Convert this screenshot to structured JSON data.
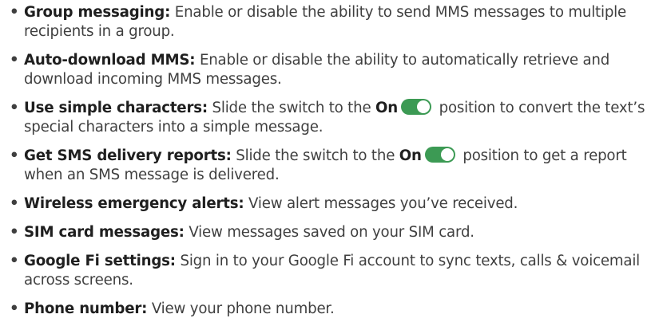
{
  "colors": {
    "text": "#3f3f3f",
    "bold_text": "#1f1f1f",
    "toggle_on": "#3c9a54"
  },
  "bullet": "•",
  "items": [
    {
      "term": "Group messaging:",
      "text": " Enable or disable the ability to send MMS messages to multiple recipients in a group."
    },
    {
      "term": "Auto-download MMS:",
      "text": " Enable or disable the ability to automatically retrieve and download incoming MMS messages."
    },
    {
      "term": "Use simple characters:",
      "text_before": " Slide the switch to the ",
      "on_label": "On",
      "toggle_state": "on",
      "text_after": " position to convert the text’s special characters into a simple message."
    },
    {
      "term": "Get SMS delivery reports:",
      "text_before": " Slide the switch to the ",
      "on_label": "On",
      "toggle_state": "on",
      "text_after": " position to get a report when an SMS message is delivered."
    },
    {
      "term": "Wireless emergency alerts:",
      "text": " View alert messages you’ve received."
    },
    {
      "term": "SIM card messages:",
      "text": " View messages saved on your SIM card."
    },
    {
      "term": "Google Fi settings:",
      "text": " Sign in to your Google Fi account to sync texts, calls & voicemail across screens."
    },
    {
      "term": "Phone number:",
      "text": " View your phone number."
    }
  ]
}
